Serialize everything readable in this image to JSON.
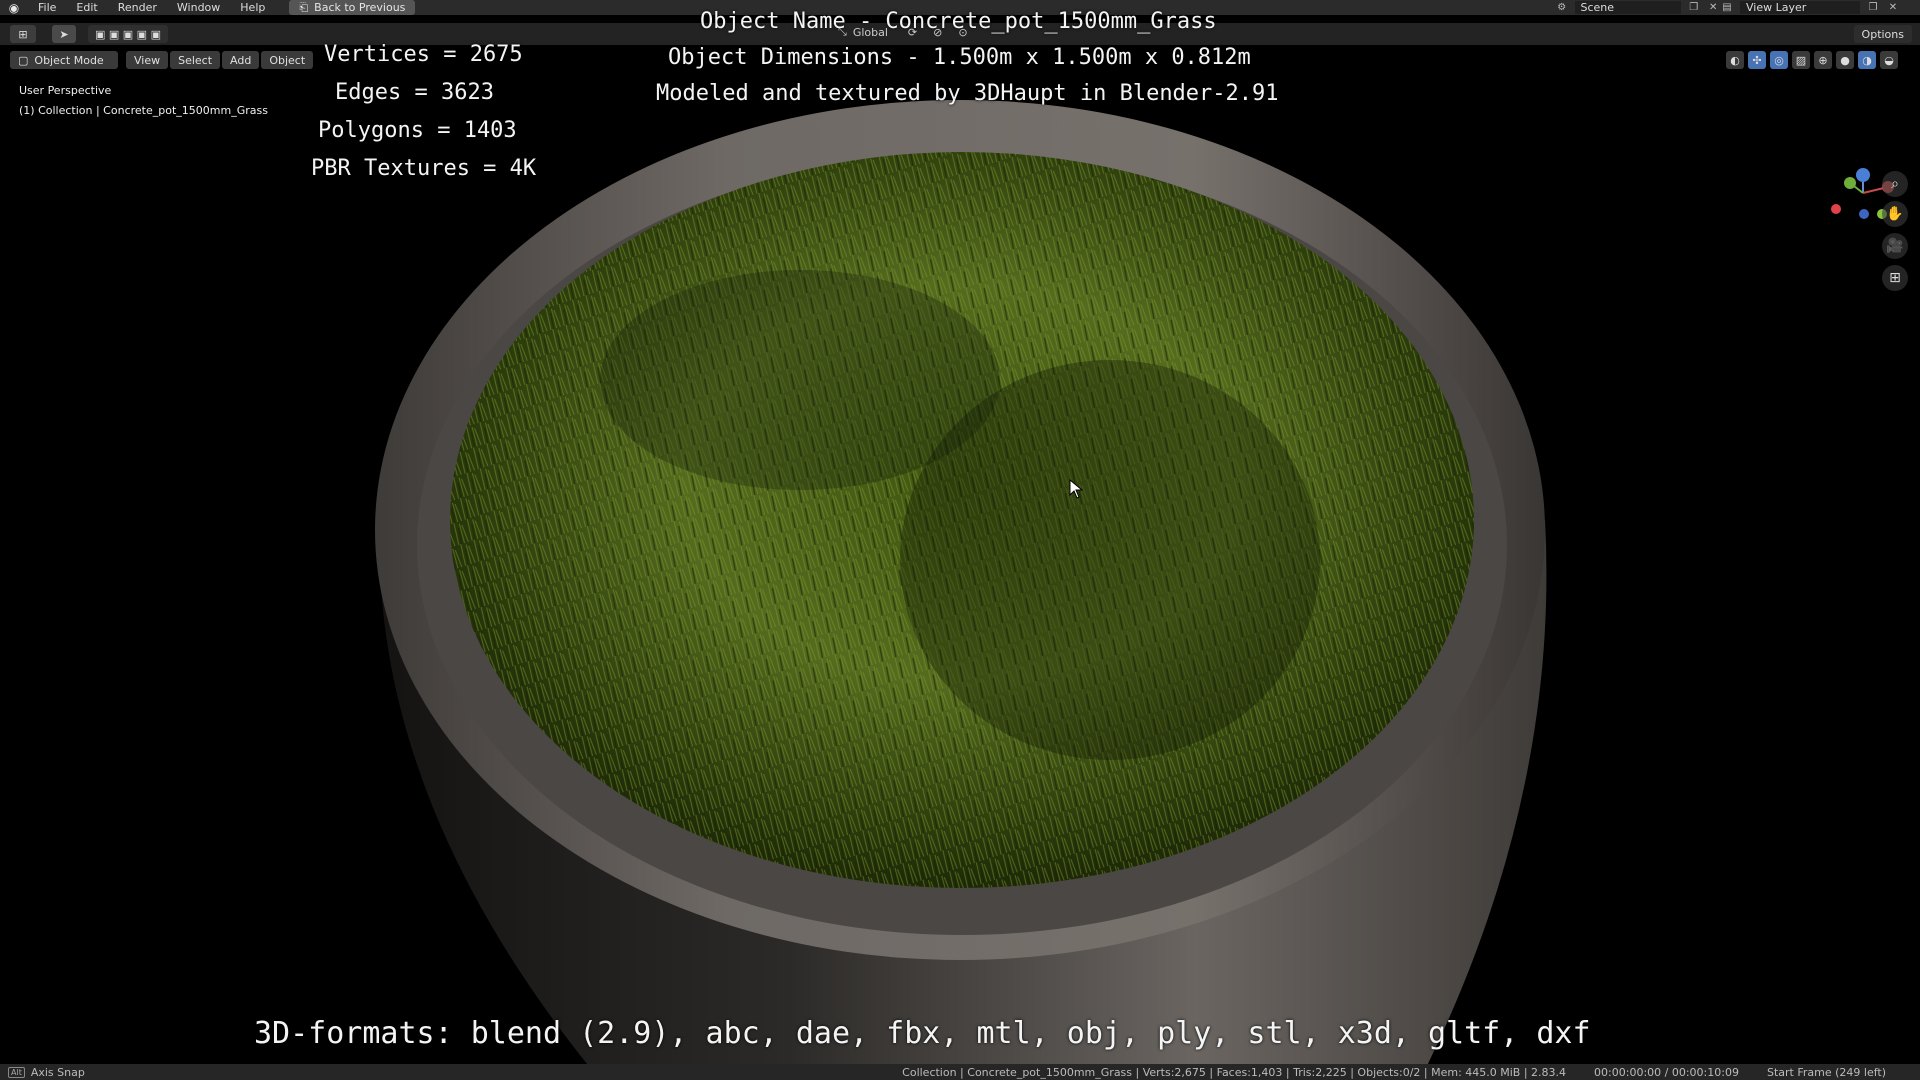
{
  "menubar": {
    "items": [
      "File",
      "Edit",
      "Render",
      "Window",
      "Help"
    ],
    "back_button": "Back to Previous",
    "scene": "Scene",
    "view_layer": "View Layer"
  },
  "toolheader": {
    "transform_orientation": "Global",
    "options_label": "Options"
  },
  "viewheader": {
    "mode": "Object Mode",
    "menus": [
      "View",
      "Select",
      "Add",
      "Object"
    ]
  },
  "viewport": {
    "perspective_label": "User Perspective",
    "collection_label": "(1) Collection | Concrete_pot_1500mm_Grass"
  },
  "overlay": {
    "object_name": "Object Name - Concrete_pot_1500mm_Grass",
    "dimensions": "Object Dimensions -  1.500m x 1.500m x 0.812m",
    "credits": "Modeled and textured by 3DHaupt in Blender-2.91",
    "vertices": "Vertices = 2675",
    "edges": "Edges = 3623",
    "polygons": "Polygons = 1403",
    "textures": "PBR Textures = 4K",
    "formats": "3D-formats: blend (2.9), abc, dae, fbx, mtl, obj, ply, stl, x3d, gltf, dxf"
  },
  "statusbar": {
    "axis_snap": "Axis Snap",
    "stats": "Collection | Concrete_pot_1500mm_Grass | Verts:2,675 | Faces:1,403 | Tris:2,225 | Objects:0/2 | Mem: 445.0 MiB | 2.83.4",
    "time": "00:00:00:00 / 00:00:10:09",
    "frame": "Start Frame (249 left)"
  },
  "colors": {
    "grass": "#556b1f",
    "concrete": "#6e6965",
    "accent_blue": "#4772b3"
  },
  "icons": [
    "blender-logo-icon",
    "back-icon",
    "scene-icon",
    "view-layer-icon",
    "zoom-icon",
    "hand-icon",
    "camera-icon",
    "grid-icon",
    "cursor-icon"
  ]
}
